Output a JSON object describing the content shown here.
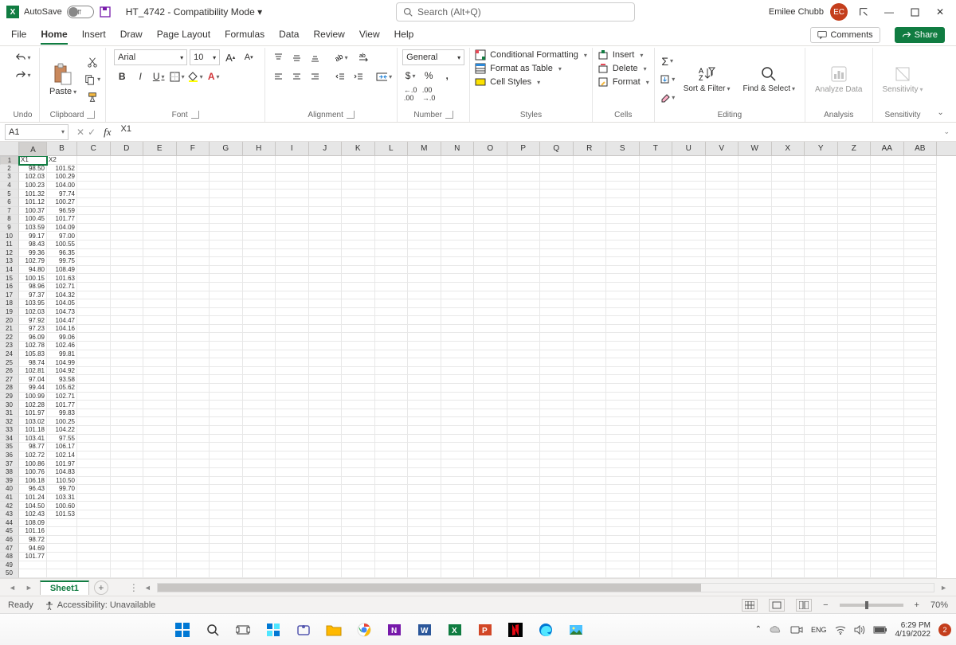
{
  "title_bar": {
    "autosave_label": "AutoSave",
    "autosave_state": "Off",
    "doc_title": "HT_4742 - Compatibility Mode ▾",
    "search_placeholder": "Search (Alt+Q)",
    "user_name": "Emilee Chubb",
    "user_initials": "EC"
  },
  "tabs": {
    "items": [
      "File",
      "Home",
      "Insert",
      "Draw",
      "Page Layout",
      "Formulas",
      "Data",
      "Review",
      "View",
      "Help"
    ],
    "active": "Home",
    "comments": "Comments",
    "share": "Share"
  },
  "ribbon": {
    "undo": "Undo",
    "clipboard": {
      "label": "Clipboard",
      "paste": "Paste"
    },
    "font": {
      "label": "Font",
      "name": "Arial",
      "size": "10",
      "bold": "B",
      "italic": "I",
      "underline": "U"
    },
    "alignment": {
      "label": "Alignment"
    },
    "number": {
      "label": "Number",
      "format": "General",
      "currency": "$",
      "percent": "%",
      "comma": ",",
      "inc": ".0",
      "dec": ".00"
    },
    "styles": {
      "label": "Styles",
      "cond": "Conditional Formatting",
      "table": "Format as Table",
      "cell": "Cell Styles"
    },
    "cells": {
      "label": "Cells",
      "insert": "Insert",
      "delete": "Delete",
      "format": "Format"
    },
    "editing": {
      "label": "Editing",
      "sort": "Sort & Filter",
      "find": "Find & Select"
    },
    "analysis": {
      "label": "Analysis",
      "analyze": "Analyze Data"
    },
    "sensitivity": {
      "label": "Sensitivity",
      "btn": "Sensitivity"
    },
    "sum": "Σ"
  },
  "formula_bar": {
    "name_box": "A1",
    "formula": "X1"
  },
  "columns": [
    "A",
    "B",
    "C",
    "D",
    "E",
    "F",
    "G",
    "H",
    "I",
    "J",
    "K",
    "L",
    "M",
    "N",
    "O",
    "P",
    "Q",
    "R",
    "S",
    "T",
    "U",
    "V",
    "W",
    "X",
    "Y",
    "Z",
    "AA",
    "AB"
  ],
  "col_widths": {
    "default": 41.5,
    "A": 35,
    "B": 38
  },
  "selected_cell": {
    "row": 1,
    "col": "A"
  },
  "data_headers": {
    "A": "X1",
    "B": "X2"
  },
  "rows": [
    {
      "A": "98.50",
      "B": "101.52"
    },
    {
      "A": "102.03",
      "B": "100.29"
    },
    {
      "A": "100.23",
      "B": "104.00"
    },
    {
      "A": "101.32",
      "B": "97.74"
    },
    {
      "A": "101.12",
      "B": "100.27"
    },
    {
      "A": "100.37",
      "B": "96.59"
    },
    {
      "A": "100.45",
      "B": "101.77"
    },
    {
      "A": "103.59",
      "B": "104.09"
    },
    {
      "A": "99.17",
      "B": "97.00"
    },
    {
      "A": "98.43",
      "B": "100.55"
    },
    {
      "A": "99.36",
      "B": "96.35"
    },
    {
      "A": "102.79",
      "B": "99.75"
    },
    {
      "A": "94.80",
      "B": "108.49"
    },
    {
      "A": "100.15",
      "B": "101.63"
    },
    {
      "A": "98.96",
      "B": "102.71"
    },
    {
      "A": "97.37",
      "B": "104.32"
    },
    {
      "A": "103.95",
      "B": "104.05"
    },
    {
      "A": "102.03",
      "B": "104.73"
    },
    {
      "A": "97.92",
      "B": "104.47"
    },
    {
      "A": "97.23",
      "B": "104.16"
    },
    {
      "A": "96.09",
      "B": "99.06"
    },
    {
      "A": "102.78",
      "B": "102.46"
    },
    {
      "A": "105.83",
      "B": "99.81"
    },
    {
      "A": "98.74",
      "B": "104.99"
    },
    {
      "A": "102.81",
      "B": "104.92"
    },
    {
      "A": "97.04",
      "B": "93.58"
    },
    {
      "A": "99.44",
      "B": "105.62"
    },
    {
      "A": "100.99",
      "B": "102.71"
    },
    {
      "A": "102.28",
      "B": "101.77"
    },
    {
      "A": "101.97",
      "B": "99.83"
    },
    {
      "A": "103.02",
      "B": "100.25"
    },
    {
      "A": "101.18",
      "B": "104.22"
    },
    {
      "A": "103.41",
      "B": "97.55"
    },
    {
      "A": "98.77",
      "B": "106.17"
    },
    {
      "A": "102.72",
      "B": "102.14"
    },
    {
      "A": "100.86",
      "B": "101.97"
    },
    {
      "A": "100.76",
      "B": "104.83"
    },
    {
      "A": "106.18",
      "B": "110.50"
    },
    {
      "A": "96.43",
      "B": "99.70"
    },
    {
      "A": "101.24",
      "B": "103.31"
    },
    {
      "A": "104.50",
      "B": "100.60"
    },
    {
      "A": "102.43",
      "B": "101.53"
    },
    {
      "A": "108.09",
      "B": ""
    },
    {
      "A": "101.16",
      "B": ""
    },
    {
      "A": "98.72",
      "B": ""
    },
    {
      "A": "94.69",
      "B": ""
    },
    {
      "A": "101.77",
      "B": ""
    }
  ],
  "total_rows": 50,
  "sheet": {
    "name": "Sheet1"
  },
  "status": {
    "ready": "Ready",
    "acc": "Accessibility: Unavailable",
    "zoom": "70%"
  },
  "taskbar": {
    "time": "6:29 PM",
    "date": "4/19/2022",
    "notif": "2"
  }
}
